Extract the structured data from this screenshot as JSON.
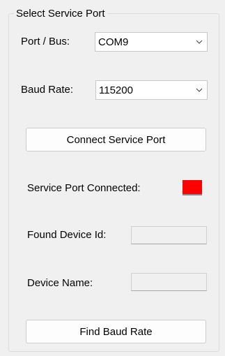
{
  "group": {
    "title": "Select Service Port"
  },
  "port": {
    "label": "Port / Bus:",
    "value": "COM9"
  },
  "baud": {
    "label": "Baud Rate:",
    "value": "115200"
  },
  "buttons": {
    "connect": "Connect Service Port",
    "find_baud": "Find Baud Rate"
  },
  "status": {
    "connected_label": "Service Port Connected:",
    "indicator_color": "#ff0000"
  },
  "device": {
    "id_label": "Found Device Id:",
    "id_value": "",
    "name_label": "Device Name:",
    "name_value": ""
  },
  "icons": {
    "dropdown": "chevron-down-icon"
  }
}
